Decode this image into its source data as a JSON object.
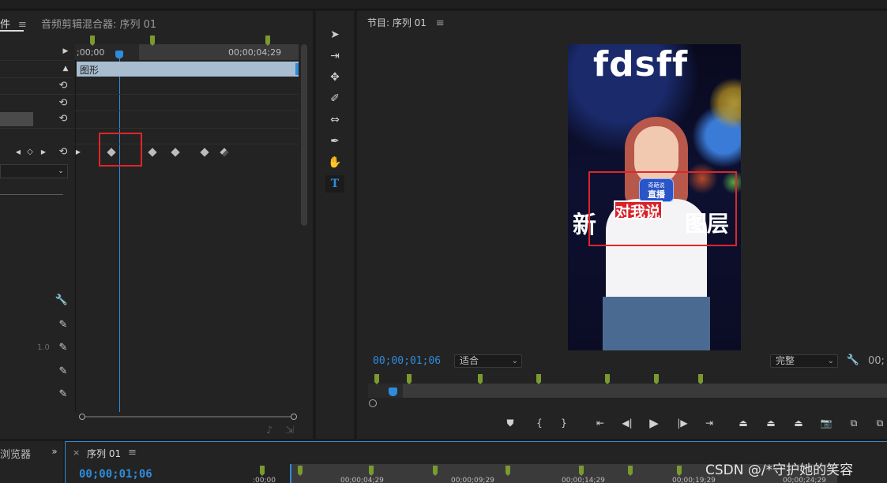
{
  "effect_controls": {
    "tab_label": "件",
    "tab_menu": "≡",
    "mixer_tab_label": "音频剪辑混合器: 序列 01",
    "ruler_start": ";00;00",
    "ruler_end": "00;00;04;29",
    "clip_label": "图形",
    "opacity_value": "1.0"
  },
  "program_monitor": {
    "title": "节目: 序列 01",
    "title_menu": "≡",
    "timecode": "00;00;01;06",
    "fit_label": "适合",
    "quality_label": "完整",
    "right_timecode": "00;",
    "video": {
      "top_text": "fdsff",
      "badge_text": "直播",
      "badge_small": "奇葩说",
      "red_text": "对我说",
      "left_text": "新",
      "right_text": "图层"
    }
  },
  "timeline": {
    "browser_tab": "浏览器",
    "close": "×",
    "tab_label": "序列 01",
    "tab_menu": "≡",
    "timecode": "00;00;01;06",
    "ruler_labels": [
      ":00;00",
      "00;00;04;29",
      "00;00;09;29",
      "00;00;14;29",
      "00;00;19;29",
      "00;00;24;29"
    ]
  },
  "watermark": "CSDN @/*守护她的笑容",
  "colors": {
    "accent_blue": "#2f8bdc",
    "marker_green": "#7a9a2f",
    "highlight_red": "#e0252a",
    "clip_bar": "#a9bdd0"
  }
}
